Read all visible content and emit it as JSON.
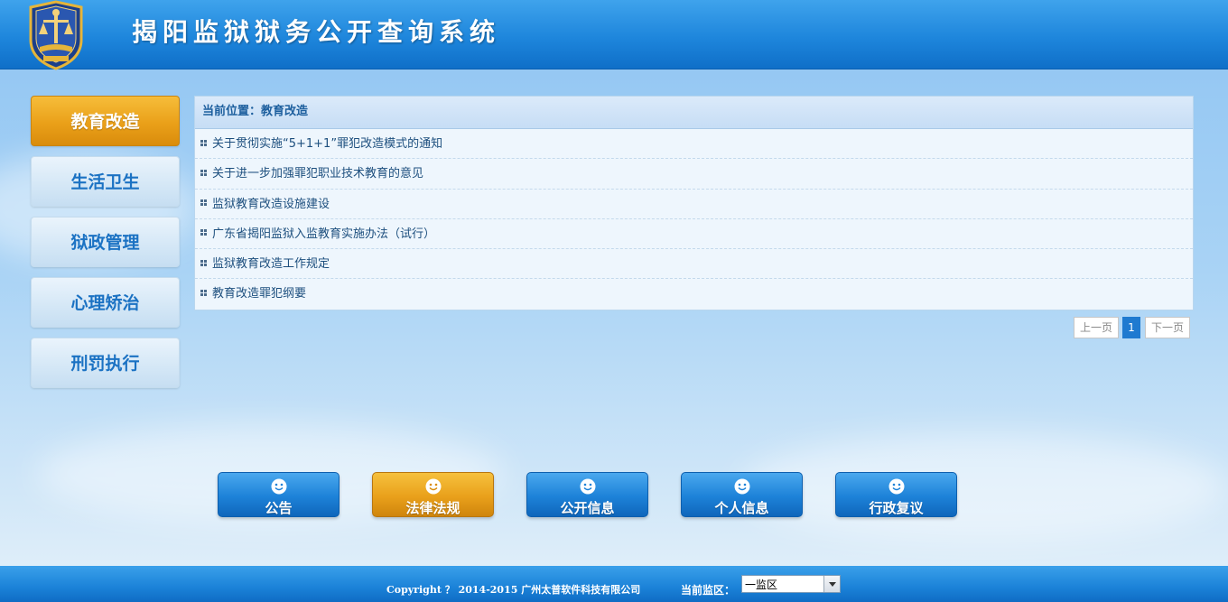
{
  "header": {
    "title": "揭阳监狱狱务公开查询系统",
    "emblem_icon": "police-emblem-icon"
  },
  "sidebar": {
    "items": [
      {
        "label": "教育改造",
        "active": true
      },
      {
        "label": "生活卫生",
        "active": false
      },
      {
        "label": "狱政管理",
        "active": false
      },
      {
        "label": "心理矫治",
        "active": false
      },
      {
        "label": "刑罚执行",
        "active": false
      }
    ]
  },
  "main": {
    "breadcrumb": "当前位置：教育改造",
    "articles": [
      "关于贯彻实施“5+1+1”罪犯改造模式的通知",
      "关于进一步加强罪犯职业技术教育的意见",
      "监狱教育改造设施建设",
      "广东省揭阳监狱入监教育实施办法（试行）",
      "监狱教育改造工作规定",
      "教育改造罪犯纲要"
    ],
    "pagination": {
      "prev_label": "上一页",
      "current_page": "1",
      "next_label": "下一页"
    }
  },
  "bottom_nav": {
    "items": [
      {
        "label": "公告",
        "icon": "smiley-icon",
        "active": false
      },
      {
        "label": "法律法规",
        "icon": "smiley-icon",
        "active": true
      },
      {
        "label": "公开信息",
        "icon": "smiley-icon",
        "active": false
      },
      {
        "label": "个人信息",
        "icon": "smiley-icon",
        "active": false
      },
      {
        "label": "行政复议",
        "icon": "smiley-icon",
        "active": false
      }
    ]
  },
  "footer": {
    "copyright": "Copyright ？ 2014-2015 广州太普软件科技有限公司",
    "region_label": "当前监区：",
    "region_value": "一监区"
  },
  "colors": {
    "brand_blue": "#1e86dc",
    "active_orange": "#eaa019",
    "link_text": "#1d4f7e"
  }
}
